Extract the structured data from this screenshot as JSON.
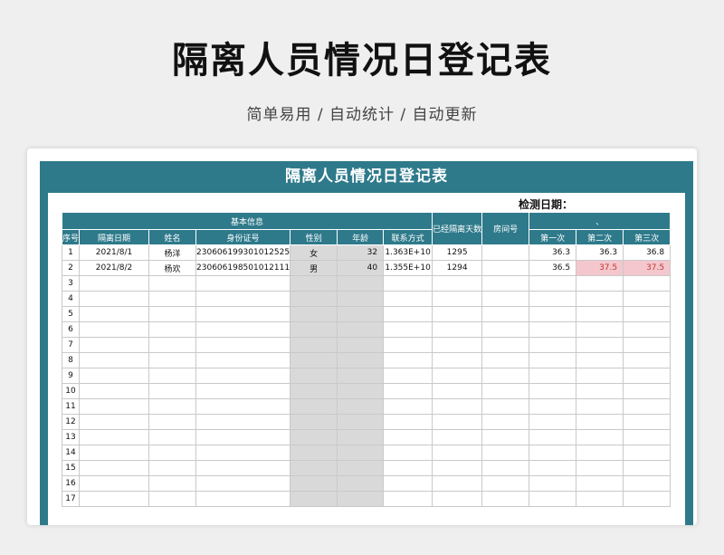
{
  "page": {
    "title": "隔离人员情况日登记表",
    "subtitle": "简单易用  /  自动统计  /  自动更新"
  },
  "sheet": {
    "title": "隔离人员情况日登记表",
    "date_label": "检测日期：",
    "header": {
      "group_basic": "基本信息",
      "days": "已经隔离天数",
      "room": "房间号",
      "temp_group": "、",
      "cols": [
        "序号",
        "隔离日期",
        "姓名",
        "身份证号",
        "性别",
        "年龄",
        "联系方式"
      ],
      "temp_cols": [
        "第一次",
        "第二次",
        "第三次"
      ]
    },
    "rows": [
      {
        "no": "1",
        "date": "2021/8/1",
        "name": "杨洋",
        "id": "230606199301012525",
        "sex": "女",
        "age": "32",
        "phone": "1.363E+10",
        "days": "1295",
        "room": "",
        "t1": "36.3",
        "t2": "36.3",
        "t3": "36.8",
        "t2_alert": false,
        "t3_alert": false
      },
      {
        "no": "2",
        "date": "2021/8/2",
        "name": "杨欢",
        "id": "230606198501012111",
        "sex": "男",
        "age": "40",
        "phone": "1.355E+10",
        "days": "1294",
        "room": "",
        "t1": "36.5",
        "t2": "37.5",
        "t3": "37.5",
        "t2_alert": true,
        "t3_alert": true
      },
      {
        "no": "3"
      },
      {
        "no": "4"
      },
      {
        "no": "5"
      },
      {
        "no": "6"
      },
      {
        "no": "7"
      },
      {
        "no": "8"
      },
      {
        "no": "9"
      },
      {
        "no": "10"
      },
      {
        "no": "11"
      },
      {
        "no": "12"
      },
      {
        "no": "13"
      },
      {
        "no": "14"
      },
      {
        "no": "15"
      },
      {
        "no": "16"
      },
      {
        "no": "17"
      }
    ]
  },
  "colors": {
    "header_teal": "#2e7a8b",
    "gray_column": "#d9d9d9",
    "alert_fill": "#f4c7ce",
    "alert_text": "#c0392b"
  }
}
